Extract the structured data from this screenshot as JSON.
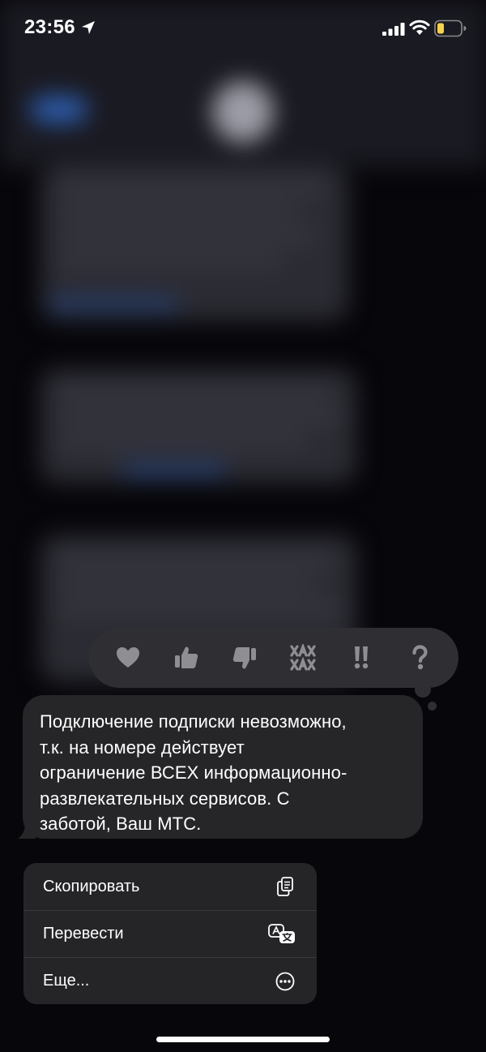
{
  "status_bar": {
    "time": "23:56",
    "icons": [
      "location-arrow-icon",
      "cellular-signal-icon",
      "wifi-icon",
      "battery-low-icon"
    ]
  },
  "reactions": [
    {
      "name": "heart",
      "icon": "heart-icon"
    },
    {
      "name": "thumbs-up",
      "icon": "thumbs-up-icon"
    },
    {
      "name": "thumbs-down",
      "icon": "thumbs-down-icon"
    },
    {
      "name": "haha",
      "icon": "haha-icon"
    },
    {
      "name": "exclamation",
      "icon": "double-exclamation-icon"
    },
    {
      "name": "question",
      "icon": "question-mark-icon"
    }
  ],
  "message": {
    "lines": [
      "Подключение подписки невозможно,",
      "т.к. на номере действует",
      "ограничение ВСЕХ информационно-",
      "развлекательных сервисов. С",
      "заботой, Ваш МТС."
    ]
  },
  "context_menu": {
    "items": [
      {
        "label": "Скопировать",
        "icon": "copy-icon"
      },
      {
        "label": "Перевести",
        "icon": "translate-icon"
      },
      {
        "label": "Еще...",
        "icon": "more-ellipsis-icon"
      }
    ]
  },
  "colors": {
    "background": "#07070b",
    "bubble": "#262629",
    "reaction_bar": "#2e2e33",
    "reaction_icon": "#8e8e93",
    "menu": "#252528",
    "battery_fill": "#f7d34a"
  }
}
